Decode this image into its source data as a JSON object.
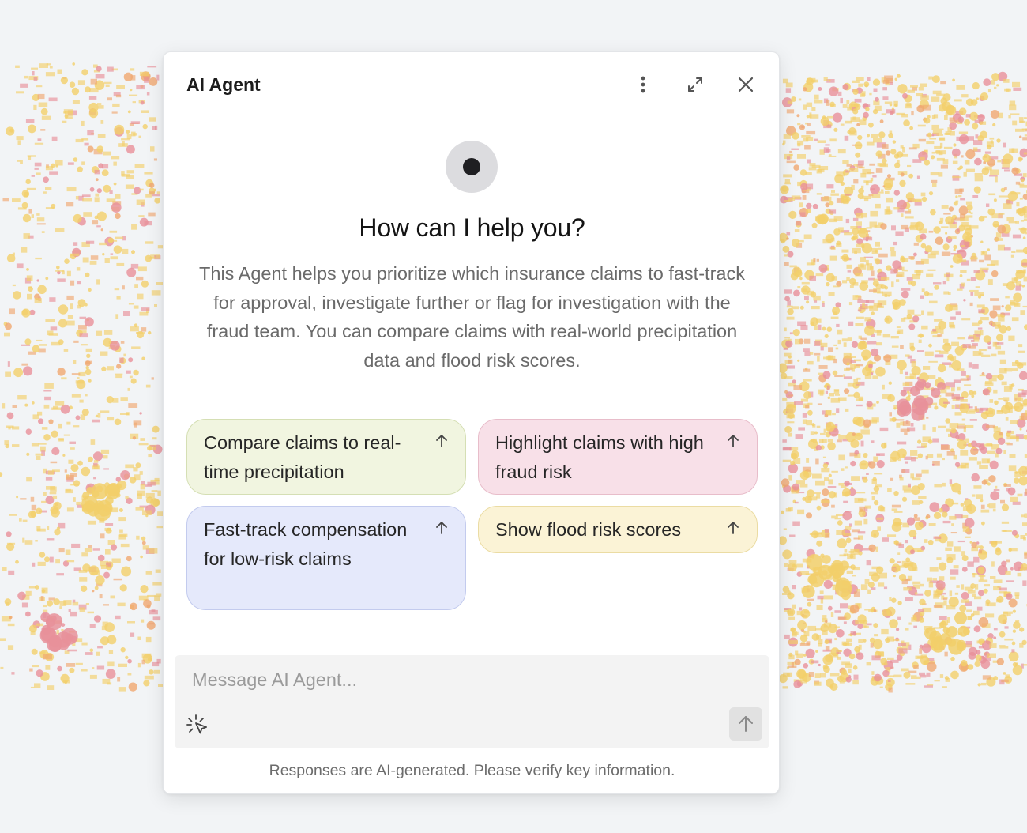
{
  "agent": {
    "title": "AI Agent",
    "icons": {
      "more": "vertical-dots-icon",
      "expand": "expand-icon",
      "close": "close-icon",
      "avatar": "agent-avatar-icon"
    }
  },
  "welcome": {
    "heading": "How can I help you?",
    "description": "This Agent helps you prioritize which insurance claims to fast-track for approval, investigate further or flag for investigation with the fraud team. You can compare claims with real-world precipitation data and flood risk scores."
  },
  "suggestions": [
    {
      "label": "Compare claims to real-time precipitation",
      "color": "#f1f5e0"
    },
    {
      "label": "Highlight claims with high fraud risk",
      "color": "#f8e0e8"
    },
    {
      "label": "Fast-track compensation for low-risk claims",
      "color": "#e5e9fb"
    },
    {
      "label": "Show flood risk scores",
      "color": "#fbf3d6"
    }
  ],
  "composer": {
    "value": "",
    "placeholder": "Message AI Agent...",
    "tool_icon": "sparkle-cursor-icon",
    "send_icon": "arrow-up-icon"
  },
  "footer": {
    "disclaimer": "Responses are AI-generated. Please verify key information."
  },
  "map": {
    "colors": {
      "yellow": "#f2cf6a",
      "pink": "#e8909a",
      "orange": "#f0a870"
    }
  }
}
